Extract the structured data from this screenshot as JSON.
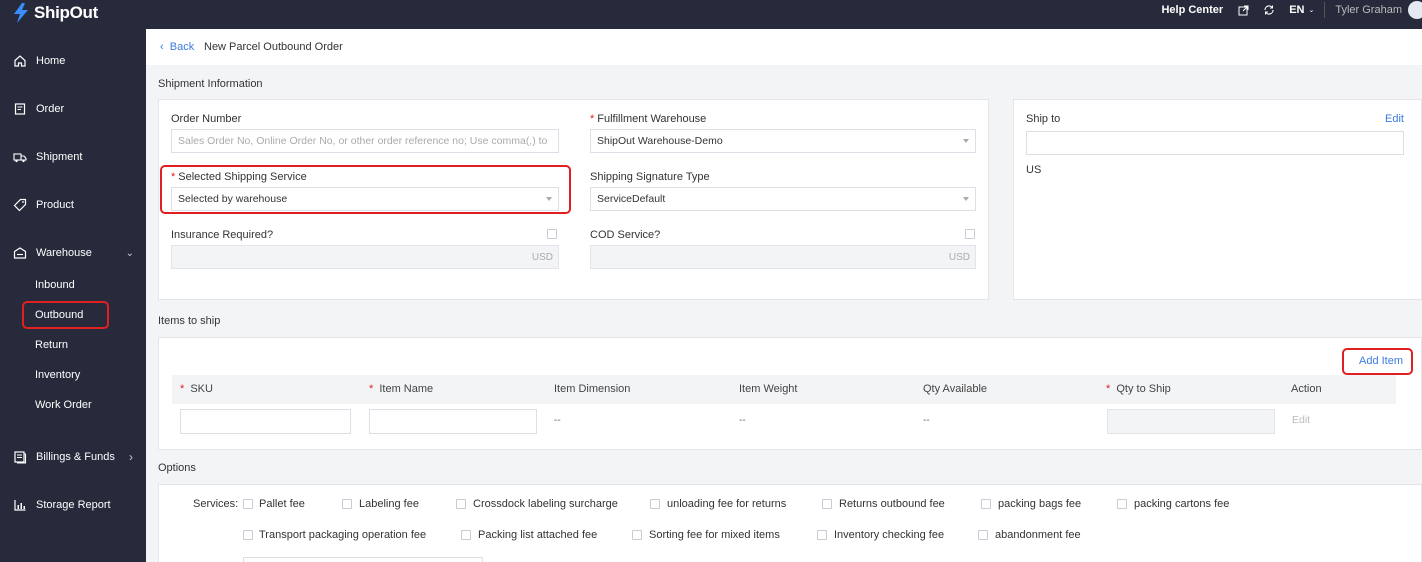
{
  "app": {
    "brand": "ShipOut"
  },
  "topbar": {
    "help": "Help Center",
    "language": "EN",
    "user": "Tyler Graham"
  },
  "sidebar": {
    "items": [
      {
        "label": "Home",
        "icon": "home-icon"
      },
      {
        "label": "Order",
        "icon": "order-icon"
      },
      {
        "label": "Shipment",
        "icon": "truck-icon"
      },
      {
        "label": "Product",
        "icon": "tag-icon"
      },
      {
        "label": "Warehouse",
        "icon": "warehouse-icon"
      },
      {
        "label": "Billings & Funds",
        "icon": "billing-icon"
      },
      {
        "label": "Storage Report",
        "icon": "chart-icon"
      }
    ],
    "warehouse_sub": [
      "Inbound",
      "Outbound",
      "Return",
      "Inventory",
      "Work Order"
    ],
    "active_sub": "Outbound"
  },
  "breadcrumb": {
    "back": "Back",
    "title": "New Parcel Outbound Order"
  },
  "shipment": {
    "section_title": "Shipment Information",
    "order_number": {
      "label": "Order Number",
      "placeholder": "Sales Order No, Online Order No, or other order reference no; Use comma(,) to"
    },
    "fulfillment_warehouse": {
      "label": "Fulfillment Warehouse",
      "value": "ShipOut Warehouse-Demo"
    },
    "shipping_service": {
      "label": "Selected Shipping Service",
      "value": "Selected by warehouse"
    },
    "signature_type": {
      "label": "Shipping Signature Type",
      "value": "ServiceDefault"
    },
    "insurance": {
      "label": "Insurance Required?",
      "suffix": "USD"
    },
    "cod": {
      "label": "COD Service?",
      "suffix": "USD"
    }
  },
  "ship_to": {
    "label": "Ship to",
    "edit": "Edit",
    "country": "US"
  },
  "items": {
    "section_title": "Items to ship",
    "add_item": "Add Item",
    "columns": [
      "SKU",
      "Item Name",
      "Item Dimension",
      "Item Weight",
      "Qty Available",
      "Qty to Ship",
      "Action"
    ],
    "row": {
      "dimension": "--",
      "weight": "--",
      "qty_available": "--",
      "action": "Edit"
    }
  },
  "options": {
    "section_title": "Options",
    "services_label": "Services:",
    "services_row1": [
      "Pallet fee",
      "Labeling fee",
      "Crossdock labeling surcharge",
      "unloading fee for returns",
      "Returns outbound fee",
      "packing bags fee",
      "packing cartons fee"
    ],
    "services_row2": [
      "Transport packaging operation fee",
      "Packing list attached fee",
      "Sorting fee for mixed items",
      "Inventory checking fee",
      "abandonment fee"
    ]
  },
  "colors": {
    "accent": "#3b7be0",
    "highlight": "#e02020",
    "sidebar": "#272a3b"
  }
}
